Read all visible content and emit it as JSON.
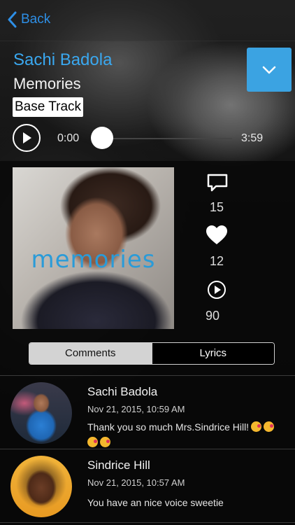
{
  "nav": {
    "back_label": "Back"
  },
  "header": {
    "artist": "Sachi Badola",
    "song": "Memories",
    "track_type": "Base Track"
  },
  "player": {
    "current_time": "0:00",
    "duration": "3:59",
    "progress": 0
  },
  "artwork": {
    "caption": "memories"
  },
  "stats": {
    "comments": "15",
    "likes": "12",
    "plays": "90"
  },
  "tabs": [
    {
      "label": "Comments",
      "active": true
    },
    {
      "label": "Lyrics",
      "active": false
    }
  ],
  "comments": [
    {
      "author": "Sachi Badola",
      "date": "Nov 21, 2015, 10:59 AM",
      "text": "Thank you so much Mrs.Sindrice Hill!"
    },
    {
      "author": "Sindrice Hill",
      "date": "Nov 21, 2015, 10:57 AM",
      "text": "You have an nice voice sweetie"
    }
  ],
  "colors": {
    "accent": "#3aa8f0",
    "dropdown": "#3ba3e2",
    "back": "#2e8fe6"
  }
}
